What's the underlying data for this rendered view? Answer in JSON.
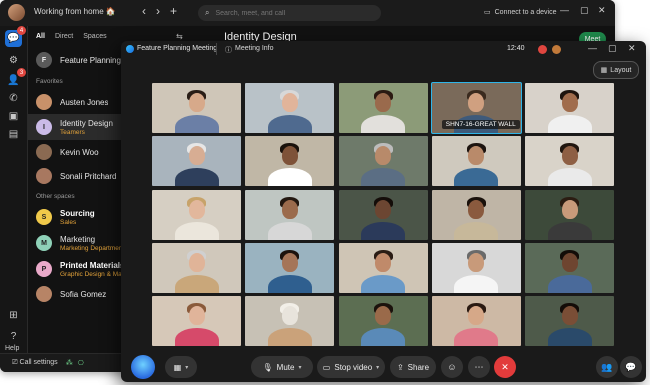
{
  "app": {
    "status_text": "Working from home 🏠",
    "search_placeholder": "Search, meet, and call",
    "connect_label": "Connect to a device",
    "tabs": [
      "All",
      "Direct",
      "Spaces"
    ],
    "favorites_label": "Favorites",
    "other_spaces_label": "Other spaces",
    "header_title": "Identity Design",
    "meet_label": "Meet",
    "help_label": "Help",
    "call_settings_label": "Call settings",
    "rail_badges": {
      "messaging": "4",
      "teams": "3"
    },
    "items": [
      {
        "name": "Feature Planning M",
        "sub": "",
        "initial": "F",
        "avatar_color": "#5a5a5a",
        "bold": false
      },
      {
        "name": "Austen Jones",
        "sub": "",
        "initial": "",
        "avatar_color": "#c8916a",
        "bold": false
      },
      {
        "name": "Identity Design",
        "sub": "Teamers",
        "initial": "I",
        "avatar_color": "#cbbbe8",
        "bold": false,
        "selected": true
      },
      {
        "name": "Kevin Woo",
        "sub": "",
        "initial": "",
        "avatar_color": "#8a6a52",
        "bold": false
      },
      {
        "name": "Sonali Pritchard",
        "sub": "",
        "initial": "",
        "avatar_color": "#a87860",
        "bold": false
      },
      {
        "name": "Sourcing",
        "sub": "Sales",
        "initial": "S",
        "avatar_color": "#f0c94a",
        "bold": true
      },
      {
        "name": "Marketing",
        "sub": "Marketing Department",
        "initial": "M",
        "avatar_color": "#8fd1b8",
        "bold": false
      },
      {
        "name": "Printed Materials",
        "sub": "Graphic Design & Ma",
        "initial": "P",
        "avatar_color": "#e9a9c9",
        "bold": true
      },
      {
        "name": "Sofia Gomez",
        "sub": "",
        "initial": "",
        "avatar_color": "#b78466",
        "bold": false
      }
    ]
  },
  "meeting": {
    "title": "Feature Planning Meeting",
    "info_label": "Meeting Info",
    "time": "12:40",
    "layout_label": "Layout",
    "room_label": "SHN7-16-GREAT WALL",
    "controls": {
      "mute_label": "Mute",
      "stop_video_label": "Stop video",
      "share_label": "Share"
    },
    "tiles": [
      {
        "bg": "#cfc6b8",
        "skin": "#d7a98a",
        "hair": "#2a1d16",
        "shirt": "#6b7fa6"
      },
      {
        "bg": "#b9c2c8",
        "skin": "#e1b49a",
        "hair": "#d8d8d8",
        "shirt": "#4f6a8f"
      },
      {
        "bg": "#8c9b78",
        "skin": "#9a6a4c",
        "hair": "#2b1a12",
        "shirt": "#e2e0dc"
      },
      {
        "bg": "#7a6a5a",
        "skin": "#d0a080",
        "hair": "#3a2a1e",
        "shirt": "#3e5a7a"
      },
      {
        "bg": "#d8d2ca",
        "skin": "#a06c4c",
        "hair": "#1e140e",
        "shirt": "#f0f0f0"
      },
      {
        "bg": "#a9b4bd",
        "skin": "#d7ad93",
        "hair": "#e6e6e6",
        "shirt": "#2e3f5c"
      },
      {
        "bg": "#c0b7a6",
        "skin": "#7e5238",
        "hair": "#1a120c",
        "shirt": "#ffffff"
      },
      {
        "bg": "#6e7a6a",
        "skin": "#b88a6a",
        "hair": "#bcbcbc",
        "shirt": "#5b6e84"
      },
      {
        "bg": "#cfc9be",
        "skin": "#b98a6a",
        "hair": "#1d1410",
        "shirt": "#3a6a95"
      },
      {
        "bg": "#d9d3c9",
        "skin": "#8e5f44",
        "hair": "#20160f",
        "shirt": "#eaeaea"
      },
      {
        "bg": "#d6cfc3",
        "skin": "#e2b79c",
        "hair": "#c7a36a",
        "shirt": "#ebe6dc"
      },
      {
        "bg": "#bfc6c2",
        "skin": "#9b6b4c",
        "hair": "#231810",
        "shirt": "#d7d7d7"
      },
      {
        "bg": "#4b5548",
        "skin": "#6c4632",
        "hair": "#140d09",
        "shirt": "#2b3a5a"
      },
      {
        "bg": "#bfb5a6",
        "skin": "#8a5a3e",
        "hair": "#1a110b",
        "shirt": "#c7b89a"
      },
      {
        "bg": "#3d4a3a",
        "skin": "#c99a7a",
        "hair": "#2b1c12",
        "shirt": "#3a3a3a"
      },
      {
        "bg": "#d0c8bb",
        "skin": "#e0b498",
        "hair": "#d0d0d0",
        "shirt": "#c9a77a"
      },
      {
        "bg": "#9ab3c0",
        "skin": "#a57558",
        "hair": "#1b120d",
        "shirt": "#2f5f8f"
      },
      {
        "bg": "#cfc5b5",
        "skin": "#c08a6a",
        "hair": "#2a1c14",
        "shirt": "#6a9ac8"
      },
      {
        "bg": "#d8d8d8",
        "skin": "#c89a7a",
        "hair": "#6a6a6a",
        "shirt": "#f5f5f5"
      },
      {
        "bg": "#5a6a58",
        "skin": "#6e4530",
        "hair": "#120c08",
        "shirt": "#4a6a9a"
      },
      {
        "bg": "#d6c8b8",
        "skin": "#e0b49a",
        "hair": "#8a5a3a",
        "shirt": "#d64a6a"
      },
      {
        "bg": "#c7c1b5",
        "skin": "#e8e4dc",
        "hair": "#f2efe8",
        "shirt": "#caa27a"
      },
      {
        "bg": "#5c6e52",
        "skin": "#9a6a4a",
        "hair": "#1b120c",
        "shirt": "#5a8ab8"
      },
      {
        "bg": "#cdb9a5",
        "skin": "#d6a888",
        "hair": "#2a1a12",
        "shirt": "#e07a8a"
      },
      {
        "bg": "#4e5a4a",
        "skin": "#7a4e36",
        "hair": "#130c08",
        "shirt": "#2a4a6a"
      }
    ]
  }
}
